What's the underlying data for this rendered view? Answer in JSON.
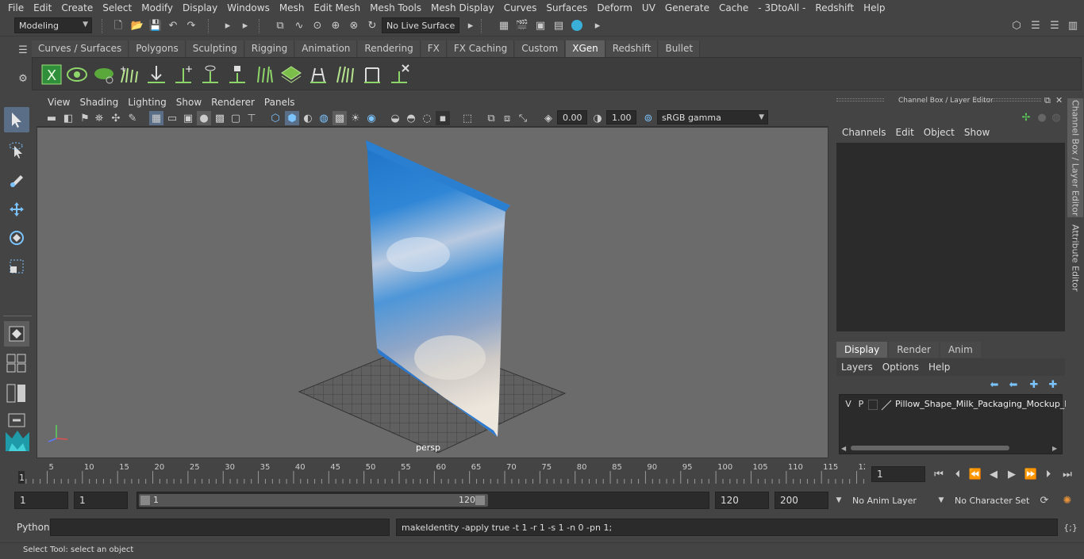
{
  "menubar": [
    "File",
    "Edit",
    "Create",
    "Select",
    "Modify",
    "Display",
    "Windows",
    "Mesh",
    "Edit Mesh",
    "Mesh Tools",
    "Mesh Display",
    "Curves",
    "Surfaces",
    "Deform",
    "UV",
    "Generate",
    "Cache",
    "- 3DtoAll -",
    "Redshift",
    "Help"
  ],
  "toolbar": {
    "mode": "Modeling",
    "live_surface": "No Live Surface"
  },
  "shelf_tabs": [
    "Curves / Surfaces",
    "Polygons",
    "Sculpting",
    "Rigging",
    "Animation",
    "Rendering",
    "FX",
    "FX Caching",
    "Custom",
    "XGen",
    "Redshift",
    "Bullet"
  ],
  "shelf_active": "XGen",
  "viewport": {
    "menu": [
      "View",
      "Shading",
      "Lighting",
      "Show",
      "Renderer",
      "Panels"
    ],
    "exposure": "0.00",
    "gamma": "1.00",
    "colorspace": "sRGB gamma",
    "camera_label": "persp"
  },
  "channel_box": {
    "title": "Channel Box / Layer Editor",
    "menu": [
      "Channels",
      "Edit",
      "Object",
      "Show"
    ]
  },
  "layer_editor": {
    "tabs": [
      "Display",
      "Render",
      "Anim"
    ],
    "active_tab": "Display",
    "menu": [
      "Layers",
      "Options",
      "Help"
    ],
    "layer": {
      "v": "V",
      "p": "P",
      "name": "Pillow_Shape_Milk_Packaging_Mockup_B"
    }
  },
  "side_tabs": [
    "Channel Box / Layer Editor",
    "Attribute Editor"
  ],
  "timeline": {
    "ticks": [
      "5",
      "10",
      "15",
      "20",
      "25",
      "30",
      "35",
      "40",
      "45",
      "50",
      "55",
      "60",
      "65",
      "70",
      "75",
      "80",
      "85",
      "90",
      "95",
      "100",
      "105",
      "110",
      "115",
      "12"
    ],
    "start_label": "1",
    "current_frame": "1"
  },
  "range": {
    "start": "1",
    "playback_start": "1",
    "slider_start": "1",
    "slider_end": "120",
    "playback_end": "120",
    "end": "200",
    "anim_layer": "No Anim Layer",
    "character_set": "No Character Set"
  },
  "command": {
    "lang": "Python",
    "output": "makeIdentity -apply true -t 1 -r 1 -s 1 -n 0 -pn 1;"
  },
  "help_line": "Select Tool: select an object"
}
